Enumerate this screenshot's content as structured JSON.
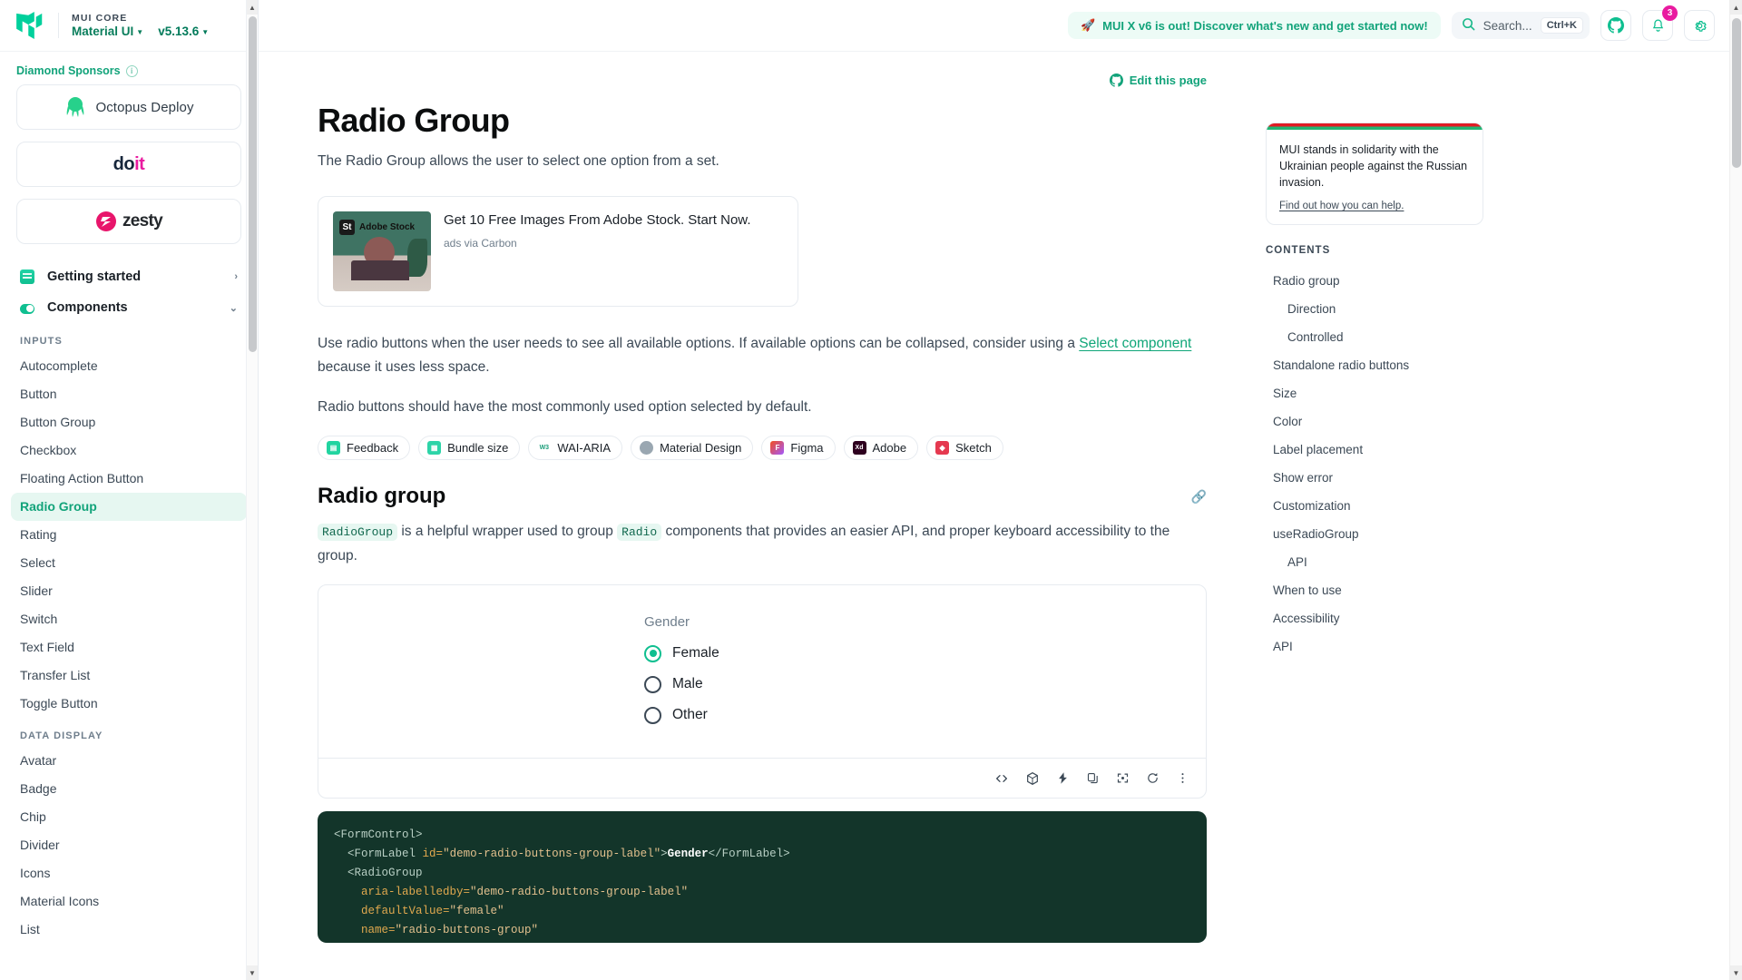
{
  "brand": {
    "core": "MUI CORE",
    "product": "Material UI",
    "version": "v5.13.6",
    "logo_color": "#00D09C"
  },
  "sponsors": {
    "heading": "Diamond Sponsors",
    "info_icon": "info-icon",
    "items": [
      {
        "name": "Octopus Deploy",
        "icon": "octopus-icon"
      },
      {
        "name": "doit",
        "icon": "doit-logo"
      },
      {
        "name": "zesty",
        "icon": "zesty-logo"
      }
    ]
  },
  "sidebar": {
    "top_items": [
      {
        "label": "Getting started",
        "icon": "book-icon",
        "chevron": "›"
      },
      {
        "label": "Components",
        "icon": "toggle-icon",
        "chevron": "⌄"
      }
    ],
    "sections": [
      {
        "label": "INPUTS",
        "items": [
          {
            "label": "Autocomplete",
            "active": false
          },
          {
            "label": "Button",
            "active": false
          },
          {
            "label": "Button Group",
            "active": false
          },
          {
            "label": "Checkbox",
            "active": false
          },
          {
            "label": "Floating Action Button",
            "active": false
          },
          {
            "label": "Radio Group",
            "active": true
          },
          {
            "label": "Rating",
            "active": false
          },
          {
            "label": "Select",
            "active": false
          },
          {
            "label": "Slider",
            "active": false
          },
          {
            "label": "Switch",
            "active": false
          },
          {
            "label": "Text Field",
            "active": false
          },
          {
            "label": "Transfer List",
            "active": false
          },
          {
            "label": "Toggle Button",
            "active": false
          }
        ]
      },
      {
        "label": "DATA DISPLAY",
        "items": [
          {
            "label": "Avatar",
            "active": false
          },
          {
            "label": "Badge",
            "active": false
          },
          {
            "label": "Chip",
            "active": false
          },
          {
            "label": "Divider",
            "active": false
          },
          {
            "label": "Icons",
            "active": false
          },
          {
            "label": "Material Icons",
            "active": false
          },
          {
            "label": "List",
            "active": false
          }
        ]
      }
    ]
  },
  "topbar": {
    "promo": "MUI X v6 is out! Discover what's new and get started now!",
    "promo_icon": "rocket-icon",
    "search_placeholder": "Search...",
    "search_shortcut": "Ctrl+K",
    "search_icon": "search-icon",
    "github_icon": "github-icon",
    "notifications_icon": "bell-icon",
    "notifications_count": "3",
    "settings_icon": "gear-icon"
  },
  "page": {
    "edit_link": "Edit this page",
    "edit_icon": "github-icon",
    "title": "Radio Group",
    "lede": "The Radio Group allows the user to select one option from a set."
  },
  "ad": {
    "logo_abbr": "St",
    "logo_text": "Adobe Stock",
    "title": "Get 10 Free Images From Adobe Stock. Start Now.",
    "source": "ads via Carbon"
  },
  "intro": {
    "part1": "Use radio buttons when the user needs to see all available options. If available options can be collapsed, consider using a ",
    "link": "Select component",
    "part2": " because it uses less space.",
    "paragraph2": "Radio buttons should have the most commonly used option selected by default."
  },
  "chips": [
    {
      "label": "Feedback",
      "icon": "feedback-icon",
      "color": "#21D4A0",
      "glyph": "▤"
    },
    {
      "label": "Bundle size",
      "icon": "bundle-icon",
      "color": "#2DD4A8",
      "glyph": "▦"
    },
    {
      "label": "WAI-ARIA",
      "icon": "w3c-icon",
      "color": "#FFFFFF",
      "glyph": "W3"
    },
    {
      "label": "Material Design",
      "icon": "material-design-icon",
      "color": "#8A8A8A",
      "glyph": "◗"
    },
    {
      "label": "Figma",
      "icon": "figma-icon",
      "color": "#F24E1E",
      "glyph": "F"
    },
    {
      "label": "Adobe",
      "icon": "adobe-xd-icon",
      "color": "#2E001F",
      "glyph": "Xd"
    },
    {
      "label": "Sketch",
      "icon": "sketch-icon",
      "color": "#F7B500",
      "glyph": "◆"
    }
  ],
  "section": {
    "title": "Radio group",
    "anchor_icon": "link-anchor-icon",
    "desc_code1": "RadioGroup",
    "desc_text1": " is a helpful wrapper used to group ",
    "desc_code2": "Radio",
    "desc_text2": " components that provides an easier API, and proper keyboard accessibility to the group."
  },
  "demo": {
    "legend": "Gender",
    "options": [
      {
        "label": "Female",
        "checked": true
      },
      {
        "label": "Male",
        "checked": false
      },
      {
        "label": "Other",
        "checked": false
      }
    ],
    "toolbar": [
      {
        "name": "show-source-icon",
        "glyph": "<>"
      },
      {
        "name": "codesandbox-icon",
        "glyph": "◈"
      },
      {
        "name": "stackblitz-icon",
        "glyph": "⚡"
      },
      {
        "name": "copy-icon",
        "glyph": "⧉"
      },
      {
        "name": "fullscreen-icon",
        "glyph": "⛶"
      },
      {
        "name": "reset-focus-icon",
        "glyph": "⟳"
      },
      {
        "name": "more-options-icon",
        "glyph": "⋮"
      }
    ]
  },
  "code": {
    "lines": [
      "<FormControl>",
      "  <FormLabel id=\"demo-radio-buttons-group-label\">Gender</FormLabel>",
      "  <RadioGroup",
      "    aria-labelledby=\"demo-radio-buttons-group-label\"",
      "    defaultValue=\"female\"",
      "    name=\"radio-buttons-group\"",
      "  >"
    ]
  },
  "solidarity": {
    "text": "MUI stands in solidarity with the Ukrainian people against the Russian invasion.",
    "link": "Find out how you can help."
  },
  "toc": {
    "heading": "CONTENTS",
    "items": [
      {
        "label": "Radio group",
        "sub": false
      },
      {
        "label": "Direction",
        "sub": true
      },
      {
        "label": "Controlled",
        "sub": true
      },
      {
        "label": "Standalone radio buttons",
        "sub": false
      },
      {
        "label": "Size",
        "sub": false
      },
      {
        "label": "Color",
        "sub": false
      },
      {
        "label": "Label placement",
        "sub": false
      },
      {
        "label": "Show error",
        "sub": false
      },
      {
        "label": "Customization",
        "sub": false
      },
      {
        "label": "useRadioGroup",
        "sub": false
      },
      {
        "label": "API",
        "sub": true
      },
      {
        "label": "When to use",
        "sub": false
      },
      {
        "label": "Accessibility",
        "sub": false
      },
      {
        "label": "API",
        "sub": false
      }
    ]
  }
}
